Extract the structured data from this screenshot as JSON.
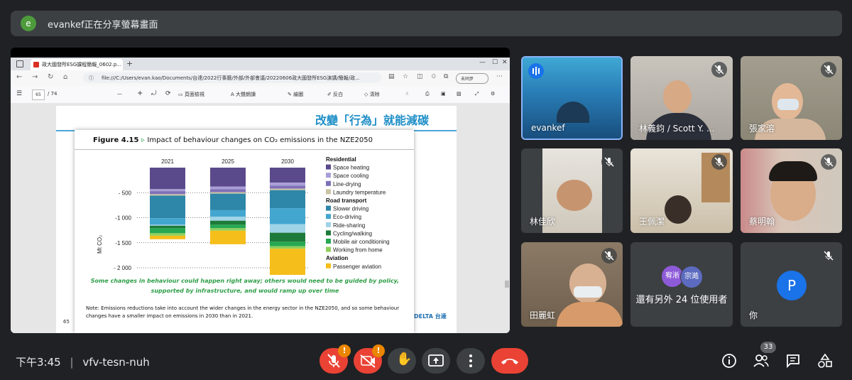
{
  "banner": {
    "avatar_letter": "e",
    "text": "evankef正在分享螢幕畫面"
  },
  "browser": {
    "tab_title": "政大國發所ESG課程簡報_0602.p...",
    "url": "file:///C:/Users/evan.kao/Documents/台達/2022行事曆/外部/外部會議/20220606政大國發所ESG演講/簡報/政...",
    "profile_label": "未同步",
    "pdf_toolbar": {
      "page_value": "65",
      "page_total": "/ 74",
      "zoom_out": "—",
      "zoom_in": "+",
      "page_view": "頁面檢視",
      "read_aloud": "大聲朗讀",
      "draw": "繪圖",
      "highlight": "反白",
      "erase": "清除"
    }
  },
  "slide": {
    "heading": "改變「行為」就能減碳",
    "page_number": "65",
    "logo_text": "DELTA 台達"
  },
  "figure": {
    "label": "Figure 4.15",
    "arrow": "▹",
    "title": "Impact of behaviour changes on CO₂ emissions in the NZE2050",
    "caption": "Some changes in behaviour could happen right away; others would need to be guided by policy, supported by infrastructure, and would ramp up over time",
    "note": "Note: Emissions reductions take into account the wider changes in the energy sector in the NZE2050, and so some behaviour changes have a smaller impact on emissions in 2030 than in 2021."
  },
  "chart_data": {
    "type": "bar",
    "stacked": true,
    "categories": [
      "2021",
      "2025",
      "2030"
    ],
    "ylabel": "Mt CO₂",
    "ylim": [
      -2000,
      0
    ],
    "yticks": [
      "- 500",
      "-1 000",
      "-1 500",
      "- 2 000"
    ],
    "ytick_values": [
      -500,
      -1000,
      -1500,
      -2000
    ],
    "grid": "dotted horizontal",
    "legend_position": "right",
    "legend_groups": [
      {
        "title": "Residential",
        "items": [
          0,
          1,
          2,
          3
        ]
      },
      {
        "title": "Road transport",
        "items": [
          4,
          5,
          6,
          7,
          8,
          9
        ]
      },
      {
        "title": "Aviation",
        "items": [
          10
        ]
      }
    ],
    "series": [
      {
        "name": "Space heating",
        "color": "#5b4a8b",
        "values": [
          -430,
          -380,
          -300
        ]
      },
      {
        "name": "Space cooling",
        "color": "#a99fd6",
        "values": [
          -40,
          -50,
          -60
        ]
      },
      {
        "name": "Line-drying",
        "color": "#7f70b8",
        "values": [
          -60,
          -60,
          -60
        ]
      },
      {
        "name": "Laundry temperature",
        "color": "#c9c3a4",
        "values": [
          -30,
          -30,
          -30
        ]
      },
      {
        "name": "Slower driving",
        "color": "#2e86a8",
        "values": [
          -450,
          -330,
          -360
        ]
      },
      {
        "name": "Eco-driving",
        "color": "#43a6cf",
        "values": [
          -130,
          -130,
          -320
        ]
      },
      {
        "name": "Ride-sharing",
        "color": "#9fd3e6",
        "values": [
          -20,
          -80,
          -170
        ]
      },
      {
        "name": "Cycling/walking",
        "color": "#1e7a3a",
        "values": [
          -50,
          -80,
          -180
        ]
      },
      {
        "name": "Mobile air conditioning",
        "color": "#26a852",
        "values": [
          -100,
          -70,
          -90
        ]
      },
      {
        "name": "Working from home",
        "color": "#8fcf5c",
        "values": [
          -50,
          -50,
          -50
        ]
      },
      {
        "name": "Passenger aviation",
        "color": "#f6be1a",
        "values": [
          -70,
          -270,
          -570
        ]
      }
    ]
  },
  "participants": [
    {
      "name": "evankef",
      "muted": false,
      "speaking": true
    },
    {
      "name": "林義鈞 / Scott Y. ...",
      "muted": true
    },
    {
      "name": "張家溶",
      "muted": true
    },
    {
      "name": "林佳欣",
      "muted": true
    },
    {
      "name": "王佩潔",
      "muted": true
    },
    {
      "name": "蔡明翰",
      "muted": true
    },
    {
      "name": "田麗虹",
      "muted": true
    },
    {
      "name": "others",
      "avatars": [
        "宥淅",
        "宗澔"
      ],
      "label": "還有另外 24 位使用者"
    },
    {
      "name": "你",
      "avatar_letter": "P",
      "muted": true
    }
  ],
  "bottom": {
    "time": "下午3:45",
    "meeting_code": "vfv-tesn-nuh",
    "mic_badge": "!",
    "cam_badge": "!",
    "people_count": "33"
  },
  "colors": {
    "background": "#202124",
    "tile": "#3c4043",
    "danger": "#ea4335",
    "accent": "#8ab4f8",
    "you_avatar": "#1a73e8"
  }
}
